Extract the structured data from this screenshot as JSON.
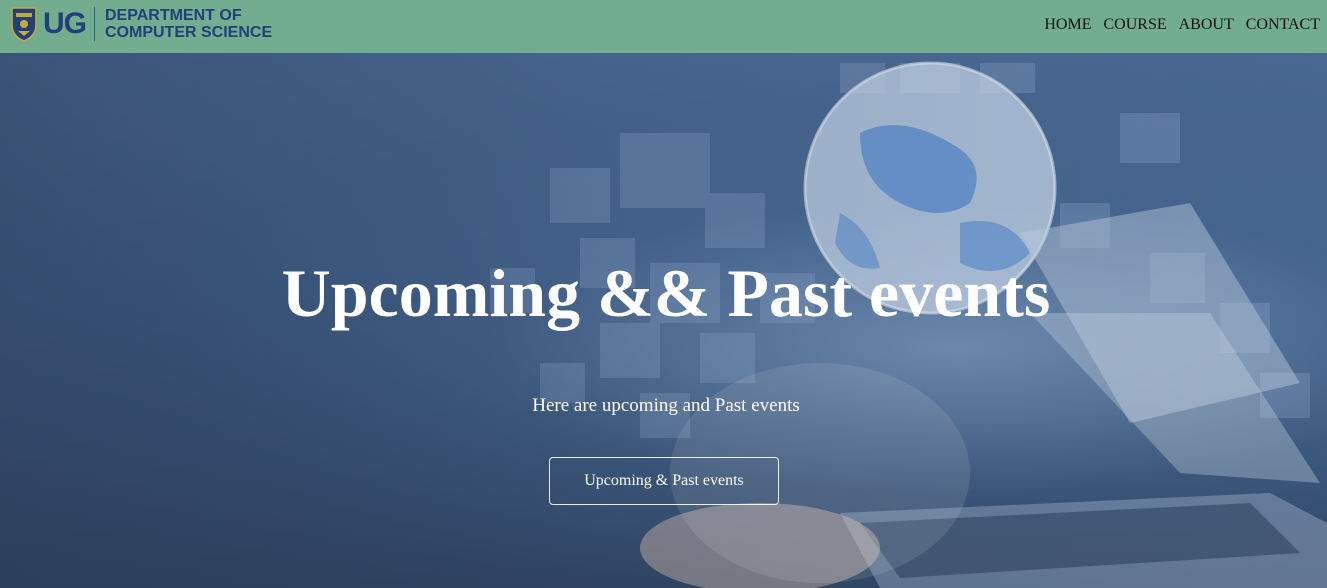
{
  "header": {
    "logo": {
      "abbr": "UG",
      "dept_line1": "DEPARTMENT OF",
      "dept_line2": "COMPUTER SCIENCE"
    },
    "nav": [
      {
        "label": "HOME"
      },
      {
        "label": "COURSE"
      },
      {
        "label": "ABOUT"
      },
      {
        "label": "CONTACT"
      }
    ]
  },
  "hero": {
    "title": "Upcoming && Past events",
    "subtitle": "Here are upcoming and Past events",
    "button_label": "Upcoming & Past events"
  },
  "colors": {
    "header_bg": "#72ad8f",
    "logo_blue": "#22407a",
    "hero_text": "#ffffff"
  }
}
